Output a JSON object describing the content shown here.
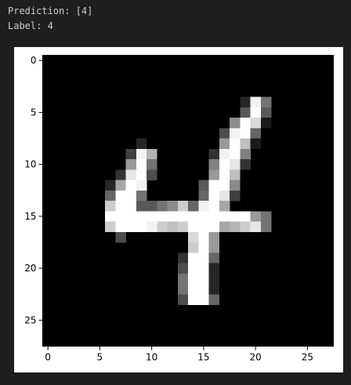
{
  "output": {
    "prediction_text": "Prediction: [4]",
    "label_text": "Label: 4"
  },
  "colors": {
    "background": "#1f1f1f",
    "text": "#cccccc",
    "figure_background": "#ffffff",
    "image_background": "#000000"
  },
  "chart_data": {
    "type": "heatmap",
    "colormap": "gray",
    "title": "",
    "xlabel": "",
    "ylabel": "",
    "grid": false,
    "xlim": [
      -0.5,
      27.5
    ],
    "ylim": [
      27.5,
      -0.5
    ],
    "x_ticks": [
      0,
      5,
      10,
      15,
      20,
      25
    ],
    "y_ticks": [
      0,
      5,
      10,
      15,
      20,
      25
    ],
    "image_size": [
      28,
      28
    ],
    "pixels": [
      {
        "r": 4,
        "c": 19,
        "v": 0.15
      },
      {
        "r": 4,
        "c": 20,
        "v": 0.95
      },
      {
        "r": 4,
        "c": 21,
        "v": 0.45
      },
      {
        "r": 5,
        "c": 19,
        "v": 0.35
      },
      {
        "r": 5,
        "c": 20,
        "v": 1.0
      },
      {
        "r": 5,
        "c": 21,
        "v": 0.35
      },
      {
        "r": 6,
        "c": 18,
        "v": 0.55
      },
      {
        "r": 6,
        "c": 19,
        "v": 1.0
      },
      {
        "r": 6,
        "c": 20,
        "v": 0.85
      },
      {
        "r": 6,
        "c": 21,
        "v": 0.1
      },
      {
        "r": 7,
        "c": 17,
        "v": 0.3
      },
      {
        "r": 7,
        "c": 18,
        "v": 0.95
      },
      {
        "r": 7,
        "c": 19,
        "v": 1.0
      },
      {
        "r": 7,
        "c": 20,
        "v": 0.4
      },
      {
        "r": 8,
        "c": 9,
        "v": 0.15
      },
      {
        "r": 8,
        "c": 17,
        "v": 0.6
      },
      {
        "r": 8,
        "c": 18,
        "v": 1.0
      },
      {
        "r": 8,
        "c": 19,
        "v": 0.75
      },
      {
        "r": 8,
        "c": 20,
        "v": 0.1
      },
      {
        "r": 9,
        "c": 8,
        "v": 0.25
      },
      {
        "r": 9,
        "c": 9,
        "v": 0.95
      },
      {
        "r": 9,
        "c": 10,
        "v": 0.7
      },
      {
        "r": 9,
        "c": 16,
        "v": 0.2
      },
      {
        "r": 9,
        "c": 17,
        "v": 0.95
      },
      {
        "r": 9,
        "c": 18,
        "v": 1.0
      },
      {
        "r": 9,
        "c": 19,
        "v": 0.5
      },
      {
        "r": 10,
        "c": 8,
        "v": 0.6
      },
      {
        "r": 10,
        "c": 9,
        "v": 1.0
      },
      {
        "r": 10,
        "c": 10,
        "v": 0.45
      },
      {
        "r": 10,
        "c": 16,
        "v": 0.5
      },
      {
        "r": 10,
        "c": 17,
        "v": 1.0
      },
      {
        "r": 10,
        "c": 18,
        "v": 0.9
      },
      {
        "r": 10,
        "c": 19,
        "v": 0.2
      },
      {
        "r": 11,
        "c": 7,
        "v": 0.2
      },
      {
        "r": 11,
        "c": 8,
        "v": 0.9
      },
      {
        "r": 11,
        "c": 9,
        "v": 1.0
      },
      {
        "r": 11,
        "c": 10,
        "v": 0.3
      },
      {
        "r": 11,
        "c": 16,
        "v": 0.6
      },
      {
        "r": 11,
        "c": 17,
        "v": 1.0
      },
      {
        "r": 11,
        "c": 18,
        "v": 0.75
      },
      {
        "r": 12,
        "c": 6,
        "v": 0.15
      },
      {
        "r": 12,
        "c": 7,
        "v": 0.65
      },
      {
        "r": 12,
        "c": 8,
        "v": 1.0
      },
      {
        "r": 12,
        "c": 9,
        "v": 0.95
      },
      {
        "r": 12,
        "c": 15,
        "v": 0.35
      },
      {
        "r": 12,
        "c": 16,
        "v": 1.0
      },
      {
        "r": 12,
        "c": 17,
        "v": 1.0
      },
      {
        "r": 12,
        "c": 18,
        "v": 0.55
      },
      {
        "r": 13,
        "c": 6,
        "v": 0.4
      },
      {
        "r": 13,
        "c": 7,
        "v": 1.0
      },
      {
        "r": 13,
        "c": 8,
        "v": 1.0
      },
      {
        "r": 13,
        "c": 9,
        "v": 0.45
      },
      {
        "r": 13,
        "c": 15,
        "v": 0.4
      },
      {
        "r": 13,
        "c": 16,
        "v": 1.0
      },
      {
        "r": 13,
        "c": 17,
        "v": 0.9
      },
      {
        "r": 13,
        "c": 18,
        "v": 0.25
      },
      {
        "r": 14,
        "c": 6,
        "v": 0.8
      },
      {
        "r": 14,
        "c": 7,
        "v": 1.0
      },
      {
        "r": 14,
        "c": 8,
        "v": 1.0
      },
      {
        "r": 14,
        "c": 9,
        "v": 0.35
      },
      {
        "r": 14,
        "c": 10,
        "v": 0.35
      },
      {
        "r": 14,
        "c": 11,
        "v": 0.45
      },
      {
        "r": 14,
        "c": 12,
        "v": 0.55
      },
      {
        "r": 14,
        "c": 13,
        "v": 0.8
      },
      {
        "r": 14,
        "c": 14,
        "v": 0.4
      },
      {
        "r": 14,
        "c": 15,
        "v": 0.95
      },
      {
        "r": 14,
        "c": 16,
        "v": 1.0
      },
      {
        "r": 14,
        "c": 17,
        "v": 0.65
      },
      {
        "r": 15,
        "c": 6,
        "v": 1.0
      },
      {
        "r": 15,
        "c": 7,
        "v": 1.0
      },
      {
        "r": 15,
        "c": 8,
        "v": 1.0
      },
      {
        "r": 15,
        "c": 9,
        "v": 1.0
      },
      {
        "r": 15,
        "c": 10,
        "v": 1.0
      },
      {
        "r": 15,
        "c": 11,
        "v": 1.0
      },
      {
        "r": 15,
        "c": 12,
        "v": 1.0
      },
      {
        "r": 15,
        "c": 13,
        "v": 1.0
      },
      {
        "r": 15,
        "c": 14,
        "v": 1.0
      },
      {
        "r": 15,
        "c": 15,
        "v": 1.0
      },
      {
        "r": 15,
        "c": 16,
        "v": 1.0
      },
      {
        "r": 15,
        "c": 17,
        "v": 1.0
      },
      {
        "r": 15,
        "c": 18,
        "v": 1.0
      },
      {
        "r": 15,
        "c": 19,
        "v": 1.0
      },
      {
        "r": 15,
        "c": 20,
        "v": 0.6
      },
      {
        "r": 15,
        "c": 21,
        "v": 0.45
      },
      {
        "r": 16,
        "c": 6,
        "v": 0.8
      },
      {
        "r": 16,
        "c": 7,
        "v": 1.0
      },
      {
        "r": 16,
        "c": 8,
        "v": 1.0
      },
      {
        "r": 16,
        "c": 9,
        "v": 1.0
      },
      {
        "r": 16,
        "c": 10,
        "v": 0.95
      },
      {
        "r": 16,
        "c": 11,
        "v": 0.8
      },
      {
        "r": 16,
        "c": 12,
        "v": 0.75
      },
      {
        "r": 16,
        "c": 13,
        "v": 0.8
      },
      {
        "r": 16,
        "c": 14,
        "v": 1.0
      },
      {
        "r": 16,
        "c": 15,
        "v": 1.0
      },
      {
        "r": 16,
        "c": 16,
        "v": 1.0
      },
      {
        "r": 16,
        "c": 17,
        "v": 0.65
      },
      {
        "r": 16,
        "c": 18,
        "v": 0.7
      },
      {
        "r": 16,
        "c": 19,
        "v": 0.8
      },
      {
        "r": 16,
        "c": 20,
        "v": 0.9
      },
      {
        "r": 16,
        "c": 21,
        "v": 0.45
      },
      {
        "r": 17,
        "c": 7,
        "v": 0.3
      },
      {
        "r": 17,
        "c": 14,
        "v": 0.85
      },
      {
        "r": 17,
        "c": 15,
        "v": 1.0
      },
      {
        "r": 17,
        "c": 16,
        "v": 0.6
      },
      {
        "r": 18,
        "c": 14,
        "v": 0.8
      },
      {
        "r": 18,
        "c": 15,
        "v": 1.0
      },
      {
        "r": 18,
        "c": 16,
        "v": 0.6
      },
      {
        "r": 19,
        "c": 13,
        "v": 0.2
      },
      {
        "r": 19,
        "c": 14,
        "v": 1.0
      },
      {
        "r": 19,
        "c": 15,
        "v": 1.0
      },
      {
        "r": 19,
        "c": 16,
        "v": 0.4
      },
      {
        "r": 20,
        "c": 13,
        "v": 0.3
      },
      {
        "r": 20,
        "c": 14,
        "v": 1.0
      },
      {
        "r": 20,
        "c": 15,
        "v": 1.0
      },
      {
        "r": 20,
        "c": 16,
        "v": 0.15
      },
      {
        "r": 21,
        "c": 13,
        "v": 0.45
      },
      {
        "r": 21,
        "c": 14,
        "v": 1.0
      },
      {
        "r": 21,
        "c": 15,
        "v": 1.0
      },
      {
        "r": 21,
        "c": 16,
        "v": 0.15
      },
      {
        "r": 22,
        "c": 13,
        "v": 0.45
      },
      {
        "r": 22,
        "c": 14,
        "v": 1.0
      },
      {
        "r": 22,
        "c": 15,
        "v": 1.0
      },
      {
        "r": 22,
        "c": 16,
        "v": 0.15
      },
      {
        "r": 23,
        "c": 13,
        "v": 0.3
      },
      {
        "r": 23,
        "c": 14,
        "v": 1.0
      },
      {
        "r": 23,
        "c": 15,
        "v": 1.0
      },
      {
        "r": 23,
        "c": 16,
        "v": 0.4
      }
    ]
  }
}
